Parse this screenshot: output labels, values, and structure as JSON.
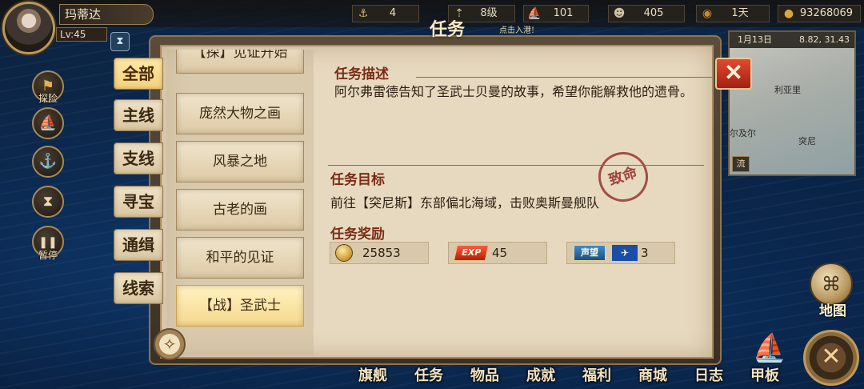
{
  "player": {
    "name": "玛蒂达",
    "level": "Lv:45"
  },
  "resources": [
    {
      "icon": "sailor-icon",
      "glyph": "⚓",
      "value": "4"
    },
    {
      "icon": "rank-icon",
      "glyph": "⇡",
      "value": "8级"
    },
    {
      "icon": "ship-icon",
      "glyph": "⛵",
      "value": "101"
    },
    {
      "icon": "crew-icon",
      "glyph": "☻",
      "value": "405"
    },
    {
      "icon": "food-icon",
      "glyph": "◉",
      "value": "1天"
    },
    {
      "icon": "gold-icon",
      "glyph": "●",
      "value": "93268069"
    }
  ],
  "side_menu": [
    {
      "icon": "flag-icon",
      "glyph": "⚑",
      "label": "探险"
    },
    {
      "icon": "sail-icon",
      "glyph": "⛵",
      "label": ""
    },
    {
      "icon": "anchor-icon",
      "glyph": "⚓",
      "label": ""
    },
    {
      "icon": "hourglass-icon",
      "glyph": "⧗",
      "label": ""
    },
    {
      "icon": "pause-icon",
      "glyph": "❚❚",
      "label": "暂停"
    }
  ],
  "panel": {
    "title": "任务",
    "port_hint": "点击入港!",
    "close_glyph": "✕"
  },
  "categories": [
    "全部",
    "主线",
    "支线",
    "寻宝",
    "通缉",
    "线索"
  ],
  "quests": [
    "【探】见证开始",
    "庞然大物之画",
    "风暴之地",
    "古老的画",
    "和平的见证",
    "【战】圣武士"
  ],
  "detail": {
    "desc_title": "任务描述",
    "desc": "阿尔弗雷德告知了圣武士贝曼的故事，希望你能解救他的遗骨。",
    "objective_title": "任务目标",
    "objective": "前往【突尼斯】东部偏北海域，击败奥斯曼舰队",
    "reward_title": "任务奖励",
    "stamp": "致命",
    "rewards": {
      "gold": "25853",
      "exp_label": "EXP",
      "exp": "45",
      "rep_label": "声望",
      "rep": "3"
    }
  },
  "minimap": {
    "date": "1月13日",
    "coords": "8.82, 31.43",
    "places": [
      "利亚里",
      "尔及尔",
      "突尼"
    ],
    "flow": "流"
  },
  "map_button": {
    "glyph": "🗺",
    "label": "地图"
  },
  "bottom_nav": [
    "旗舰",
    "任务",
    "物品",
    "成就",
    "福利",
    "商城",
    "日志",
    "甲板"
  ]
}
